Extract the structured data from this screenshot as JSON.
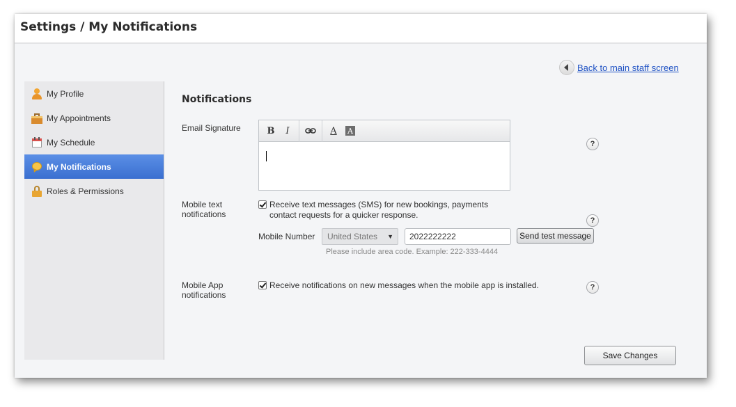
{
  "header": {
    "title": "Settings / My Notifications"
  },
  "back_link": {
    "label": "Back to main staff screen"
  },
  "sidebar": {
    "items": [
      {
        "label": "My Profile",
        "icon": "profile-icon",
        "active": false
      },
      {
        "label": "My Appointments",
        "icon": "appointments-icon",
        "active": false
      },
      {
        "label": "My Schedule",
        "icon": "calendar-icon",
        "active": false
      },
      {
        "label": "My Notifications",
        "icon": "notification-bubble-icon",
        "active": true
      },
      {
        "label": "Roles & Permissions",
        "icon": "lock-icon",
        "active": false
      }
    ]
  },
  "main": {
    "title": "Notifications",
    "email_signature": {
      "label": "Email Signature",
      "toolbar": {
        "bold": "B",
        "italic": "I",
        "link_icon": "link-icon",
        "font_color": "A",
        "bg_color": "A"
      },
      "value": ""
    },
    "mobile_text": {
      "label_line1": "Mobile text",
      "label_line2": "notifications",
      "checkbox_checked": true,
      "checkbox_line1": "Receive text messages (SMS) for new bookings, payments",
      "checkbox_line2": "contact requests for a quicker response.",
      "mobile_number_label": "Mobile Number",
      "country": "United States",
      "phone": "2022222222",
      "send_test_label": "Send test message",
      "hint": "Please include area code. Example: 222-333-4444"
    },
    "mobile_app": {
      "label_line1": "Mobile App",
      "label_line2": "notifications",
      "checkbox_checked": true,
      "checkbox_text": "Receive notifications on new messages when the mobile app is installed."
    },
    "help_glyph": "?",
    "save_label": "Save Changes"
  },
  "colors": {
    "active_nav": "#3a6fd0",
    "link": "#1f52c4"
  }
}
